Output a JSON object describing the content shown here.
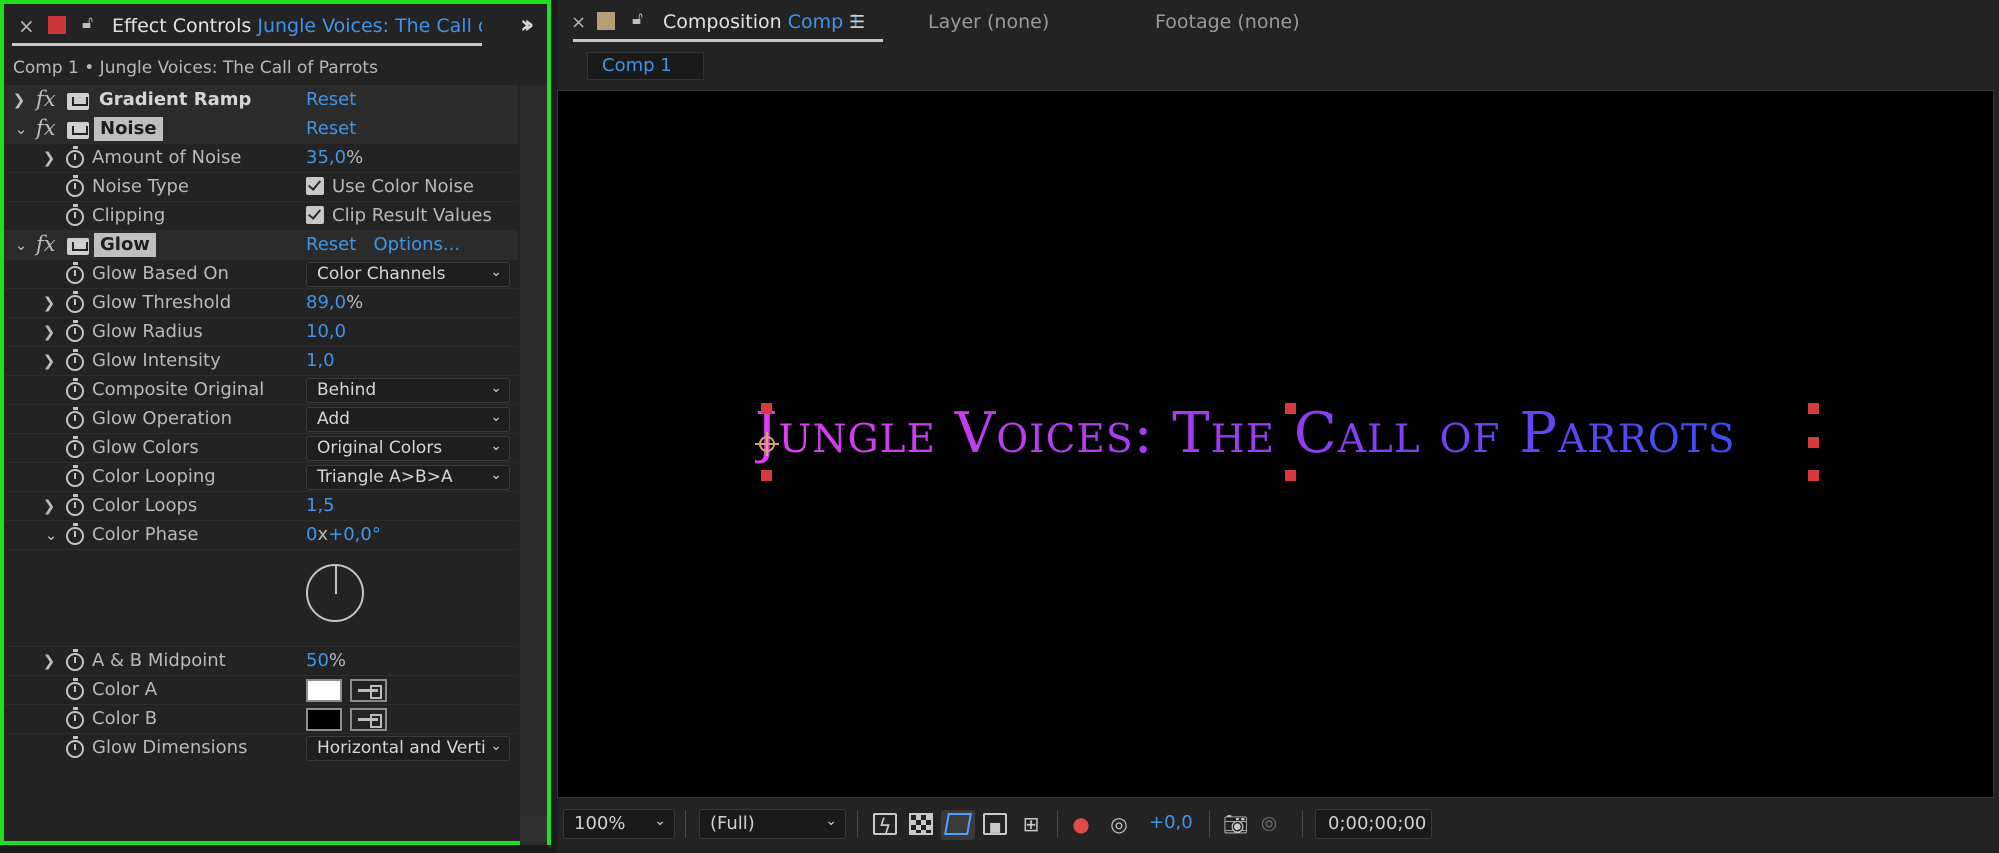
{
  "effect_panel": {
    "tab_label": "Effect Controls",
    "tab_layer": "Jungle Voices: The Call of Par",
    "breadcrumb": "Comp 1 • Jungle Voices: The Call of Parrots",
    "effects": {
      "gradient_ramp": {
        "name": "Gradient Ramp",
        "reset": "Reset"
      },
      "noise": {
        "name": "Noise",
        "reset": "Reset",
        "amount_label": "Amount of Noise",
        "amount_value": "35,0",
        "amount_unit": "%",
        "type_label": "Noise Type",
        "type_value": "Use Color Noise",
        "clipping_label": "Clipping",
        "clipping_value": "Clip Result Values"
      },
      "glow": {
        "name": "Glow",
        "reset": "Reset",
        "options": "Options...",
        "based_on_label": "Glow Based On",
        "based_on_value": "Color Channels",
        "threshold_label": "Glow Threshold",
        "threshold_value": "89,0",
        "threshold_unit": "%",
        "radius_label": "Glow Radius",
        "radius_value": "10,0",
        "intensity_label": "Glow Intensity",
        "intensity_value": "1,0",
        "composite_label": "Composite Original",
        "composite_value": "Behind",
        "operation_label": "Glow Operation",
        "operation_value": "Add",
        "colors_label": "Glow Colors",
        "colors_value": "Original Colors",
        "looping_label": "Color Looping",
        "looping_value": "Triangle A>B>A",
        "loops_label": "Color Loops",
        "loops_value": "1,5",
        "phase_label": "Color Phase",
        "phase_rev": "0",
        "phase_x": "x",
        "phase_deg": "+0,0°",
        "midpoint_label": "A & B Midpoint",
        "midpoint_value": "50",
        "midpoint_unit": "%",
        "color_a_label": "Color A",
        "color_a": "#ffffff",
        "color_b_label": "Color B",
        "color_b": "#000000",
        "dimensions_label": "Glow Dimensions",
        "dimensions_value": "Horizontal and Verti"
      }
    }
  },
  "comp_panel": {
    "tab_label": "Composition",
    "tab_comp": "Comp 1",
    "layer_tab": "Layer (none)",
    "footage_tab": "Footage (none)",
    "subtab": "Comp 1",
    "canvas_text": "Jungle Voices: The Call of Parrots",
    "toolbar": {
      "zoom": "100%",
      "resolution": "(Full)",
      "exposure": "+0,0",
      "timecode": "0;00;00;00"
    }
  },
  "colors": {
    "accent": "#3e95e8",
    "panel_border": "#22e01f",
    "label_red": "#c8363a",
    "label_tan": "#b59e7a",
    "text_gradient_start": "#e23cf5",
    "text_gradient_end": "#3b4df2"
  },
  "icons": [
    "close-icon",
    "lock-icon",
    "panel-menu-icon",
    "stopwatch-icon",
    "eyedropper-icon",
    "camera-icon"
  ]
}
